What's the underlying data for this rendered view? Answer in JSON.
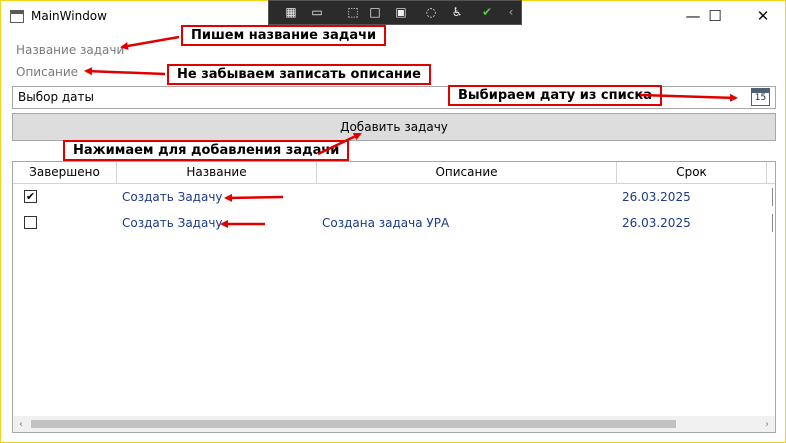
{
  "window": {
    "title": "MainWindow"
  },
  "window_controls": {
    "minimize": "—",
    "maximize": "☐",
    "close": "✕"
  },
  "toolbar": {
    "items": [
      "▦",
      "▭",
      "⬚",
      "□",
      "▣",
      "◌",
      "♿",
      "✔",
      "‹"
    ]
  },
  "form": {
    "task_name_placeholder": "Название задачи",
    "description_placeholder": "Описание",
    "date_picker_placeholder": "Выбор даты",
    "calendar_day": "15",
    "add_button": "Добавить задачу"
  },
  "annotations": {
    "write_name": "Пишем название задачи",
    "write_description": "Не забываем записать описание",
    "choose_date": "Выбираем дату из списка",
    "press_add": "Нажимаем для добавления задачи"
  },
  "grid": {
    "columns": [
      "Завершено",
      "Название",
      "Описание",
      "Срок"
    ],
    "rows": [
      {
        "done": true,
        "done_mark": "✔",
        "name": "Создать Задачу",
        "description": "",
        "due": "26.03.2025"
      },
      {
        "done": false,
        "done_mark": "",
        "name": "Создать Задачу",
        "description": "Создана задача УРА",
        "due": "26.03.2025"
      }
    ],
    "scroll_left": "‹",
    "scroll_right": "›"
  },
  "colors": {
    "annotation_border": "#e00000",
    "window_border": "#f2d21a",
    "cell_text": "#1a3a8a"
  }
}
